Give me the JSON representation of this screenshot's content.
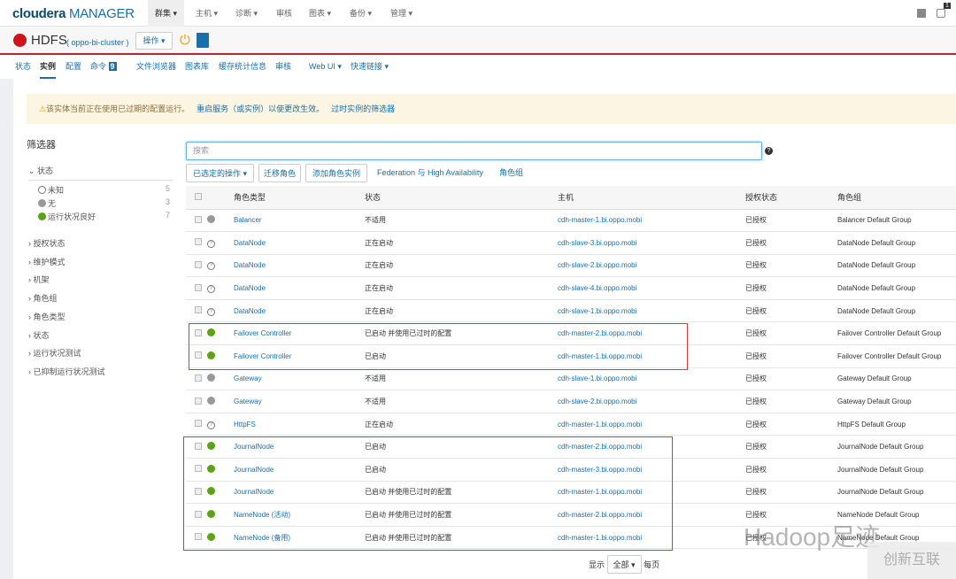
{
  "topnav": {
    "logo_bold": "cloudera",
    "logo_light": " MANAGER",
    "menus": [
      "群集 ▾",
      "主机 ▾",
      "诊断 ▾",
      "审核",
      "图表 ▾",
      "备份 ▾",
      "管理 ▾"
    ],
    "badge": "1"
  },
  "service": {
    "name": "HDFS",
    "cluster": "( oppo-bi-cluster )",
    "actions": "操作 ▾"
  },
  "tabs": [
    "状态",
    "实例",
    "配置",
    "命令",
    "文件浏览器",
    "图表库",
    "缓存统计信息",
    "审核",
    "Web UI ▾",
    "快速链接 ▾"
  ],
  "command_count": "9",
  "warning": {
    "text": "该实体当前正在使用已过期的配置运行。",
    "restart_link": "重启服务（或实例）以使更改生效。",
    "filter_link": "过时实例的筛选器"
  },
  "filters": {
    "title": "筛选器",
    "status_section": "状态",
    "status_items": [
      {
        "label": "未知",
        "count": "5"
      },
      {
        "label": "无",
        "count": "3"
      },
      {
        "label": "运行状况良好",
        "count": "7"
      }
    ],
    "sections": [
      "授权状态",
      "维护模式",
      "机架",
      "角色组",
      "角色类型",
      "状态",
      "运行状况测试",
      "已抑制运行状况测试"
    ]
  },
  "search": {
    "placeholder": "搜索"
  },
  "actions": {
    "selected": "已选定的操作 ▾",
    "migrate": "迁移角色",
    "add": "添加角色实例",
    "federation": "Federation 与 High Availability",
    "role_groups": "角色组"
  },
  "table": {
    "headers": [
      "角色类型",
      "状态",
      "主机",
      "授权状态",
      "角色组"
    ],
    "rows": [
      {
        "health": "grey",
        "role": "Balancer",
        "state": "不适用",
        "host": "cdh-master-1.bi.oppo.mobi",
        "auth": "已授权",
        "group": "Balancer Default Group"
      },
      {
        "health": "unknown",
        "role": "DataNode",
        "state": "正在启动",
        "host": "cdh-slave-3.bi.oppo.mobi",
        "auth": "已授权",
        "group": "DataNode Default Group"
      },
      {
        "health": "unknown",
        "role": "DataNode",
        "state": "正在启动",
        "host": "cdh-slave-2.bi.oppo.mobi",
        "auth": "已授权",
        "group": "DataNode Default Group"
      },
      {
        "health": "unknown",
        "role": "DataNode",
        "state": "正在启动",
        "host": "cdh-slave-4.bi.oppo.mobi",
        "auth": "已授权",
        "group": "DataNode Default Group"
      },
      {
        "health": "unknown",
        "role": "DataNode",
        "state": "正在启动",
        "host": "cdh-slave-1.bi.oppo.mobi",
        "auth": "已授权",
        "group": "DataNode Default Group"
      },
      {
        "health": "green",
        "role": "Failover Controller",
        "state": "已启动 并使用已过时的配置",
        "host": "cdh-master-2.bi.oppo.mobi",
        "auth": "已授权",
        "group": "Failover Controller Default Group"
      },
      {
        "health": "green",
        "role": "Failover Controller",
        "state": "已启动",
        "host": "cdh-master-1.bi.oppo.mobi",
        "auth": "已授权",
        "group": "Failover Controller Default Group"
      },
      {
        "health": "grey",
        "role": "Gateway",
        "state": "不适用",
        "host": "cdh-slave-1.bi.oppo.mobi",
        "auth": "已授权",
        "group": "Gateway Default Group"
      },
      {
        "health": "grey",
        "role": "Gateway",
        "state": "不适用",
        "host": "cdh-slave-2.bi.oppo.mobi",
        "auth": "已授权",
        "group": "Gateway Default Group"
      },
      {
        "health": "unknown",
        "role": "HttpFS",
        "state": "正在启动",
        "host": "cdh-master-1.bi.oppo.mobi",
        "auth": "已授权",
        "group": "HttpFS Default Group"
      },
      {
        "health": "green",
        "role": "JournalNode",
        "state": "已启动",
        "host": "cdh-master-2.bi.oppo.mobi",
        "auth": "已授权",
        "group": "JournalNode Default Group"
      },
      {
        "health": "green",
        "role": "JournalNode",
        "state": "已启动",
        "host": "cdh-master-3.bi.oppo.mobi",
        "auth": "已授权",
        "group": "JournalNode Default Group"
      },
      {
        "health": "green",
        "role": "JournalNode",
        "state": "已启动 并使用已过时的配置",
        "host": "cdh-master-1.bi.oppo.mobi",
        "auth": "已授权",
        "group": "JournalNode Default Group"
      },
      {
        "health": "green",
        "role": "NameNode (活动)",
        "state": "已启动 并使用已过时的配置",
        "host": "cdh-master-2.bi.oppo.mobi",
        "auth": "已授权",
        "group": "NameNode Default Group"
      },
      {
        "health": "green",
        "role": "NameNode (备用)",
        "state": "已启动 并使用已过时的配置",
        "host": "cdh-master-1.bi.oppo.mobi",
        "auth": "已授权",
        "group": "NameNode Default Group"
      }
    ]
  },
  "pager": {
    "show": "显示",
    "value": "全部",
    "per_page": "每页"
  },
  "watermarks": [
    "Hadoop足迹",
    "创新互联"
  ],
  "colors": {
    "accent": "#1a6fa8",
    "healthy": "#5aa313",
    "bad": "#d0121b",
    "highlight_box": "#e0353b"
  }
}
